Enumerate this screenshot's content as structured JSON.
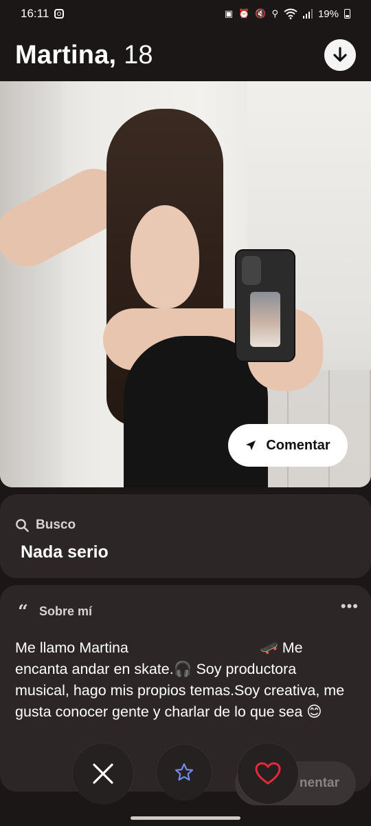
{
  "status_bar": {
    "time": "16:11",
    "battery": "19%",
    "icons": [
      "instagram-icon",
      "battery-saver-icon",
      "alarm-icon",
      "mute-icon",
      "location-icon",
      "wifi-icon",
      "signal-icon",
      "battery-icon"
    ]
  },
  "profile": {
    "name": "Martina,",
    "age": "18"
  },
  "photo": {
    "comment_label": "Comentar"
  },
  "busco": {
    "label": "Busco",
    "value": "Nada serio"
  },
  "about": {
    "label": "Sobre mí",
    "text": "Me llamo Martina                                🛹 Me encanta andar en skate.🎧 Soy productora musical, hago mis propios temas.Soy creativa, me gusta conocer gente y charlar de lo que sea 😊"
  },
  "actions": {
    "ghost_comment_label": "nentar"
  },
  "colors": {
    "background": "#1b1716",
    "card": "#2c2726",
    "heart": "#e8293c",
    "star": "#6f8df0"
  }
}
